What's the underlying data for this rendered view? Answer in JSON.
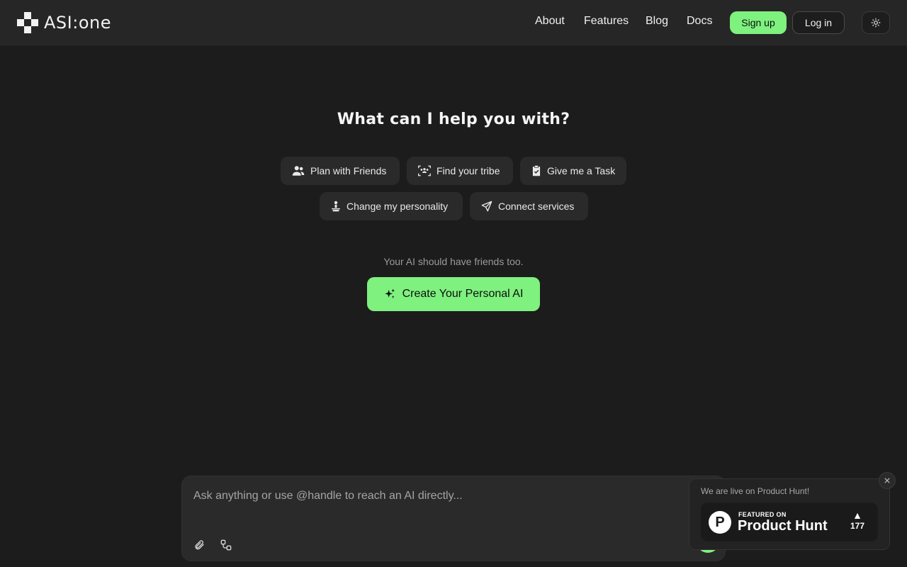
{
  "header": {
    "brand": "ASI:one",
    "nav": [
      {
        "label": "About"
      },
      {
        "label": "Features"
      },
      {
        "label": "Blog"
      },
      {
        "label": "Docs"
      }
    ],
    "signup_label": "Sign up",
    "login_label": "Log in",
    "theme_toggle_icon": "sun-icon"
  },
  "hero": {
    "headline": "What can I help you with?",
    "suggestions": [
      {
        "label": "Plan with Friends",
        "icon": "users-icon"
      },
      {
        "label": "Find your tribe",
        "icon": "group-scan-icon"
      },
      {
        "label": "Give me a Task",
        "icon": "clipboard-check-icon"
      },
      {
        "label": "Change my personality",
        "icon": "person-icon"
      },
      {
        "label": "Connect services",
        "icon": "send-icon"
      }
    ],
    "tagline": "Your AI should have friends too.",
    "cta_label": "Create Your Personal AI",
    "cta_icon": "sparkles-icon"
  },
  "composer": {
    "placeholder": "Ask anything or use @handle to reach an AI directly...",
    "value": "",
    "tools": [
      "paperclip-icon",
      "workflow-icon"
    ]
  },
  "product_hunt": {
    "note": "We are live on Product Hunt!",
    "featured": "FEATURED ON",
    "name": "Product Hunt",
    "logo_letter": "P",
    "votes": "177"
  },
  "colors": {
    "accent": "#7ef17e",
    "background": "#1c1c1c",
    "header": "#262626",
    "chip": "#2a2a2a"
  }
}
